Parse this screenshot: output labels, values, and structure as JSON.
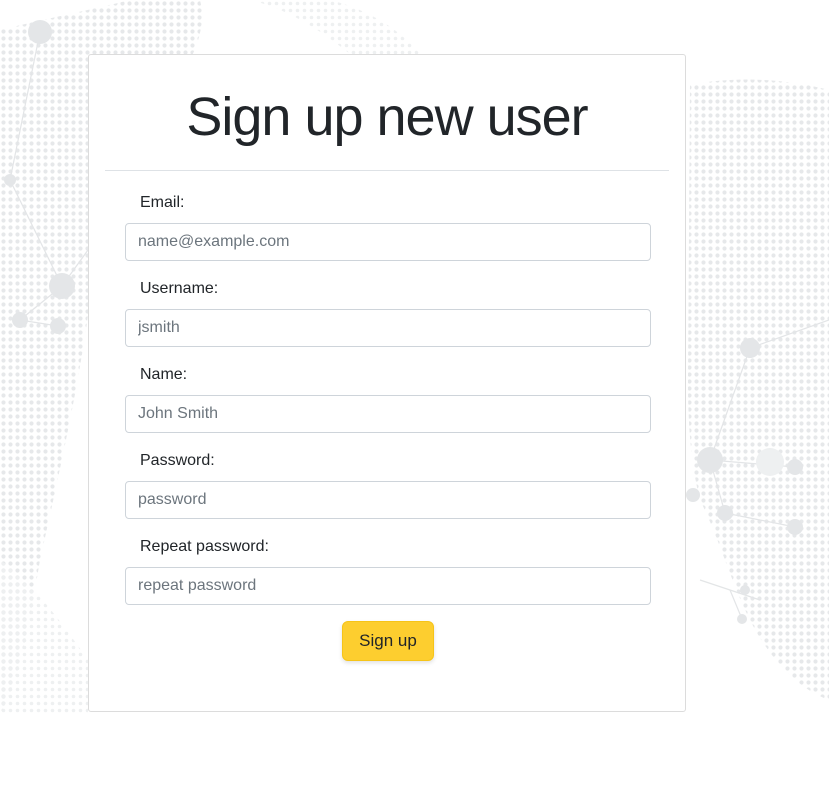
{
  "form": {
    "title": "Sign up new user",
    "fields": [
      {
        "label": "Email:",
        "placeholder": "name@example.com"
      },
      {
        "label": "Username:",
        "placeholder": "jsmith"
      },
      {
        "label": "Name:",
        "placeholder": "John Smith"
      },
      {
        "label": "Password:",
        "placeholder": "password"
      },
      {
        "label": "Repeat password:",
        "placeholder": "repeat password"
      }
    ],
    "submit_label": "Sign up"
  },
  "colors": {
    "accent": "#fdce2f",
    "card_border": "#dcdcdc",
    "background_pattern": "#e8eaeb"
  }
}
